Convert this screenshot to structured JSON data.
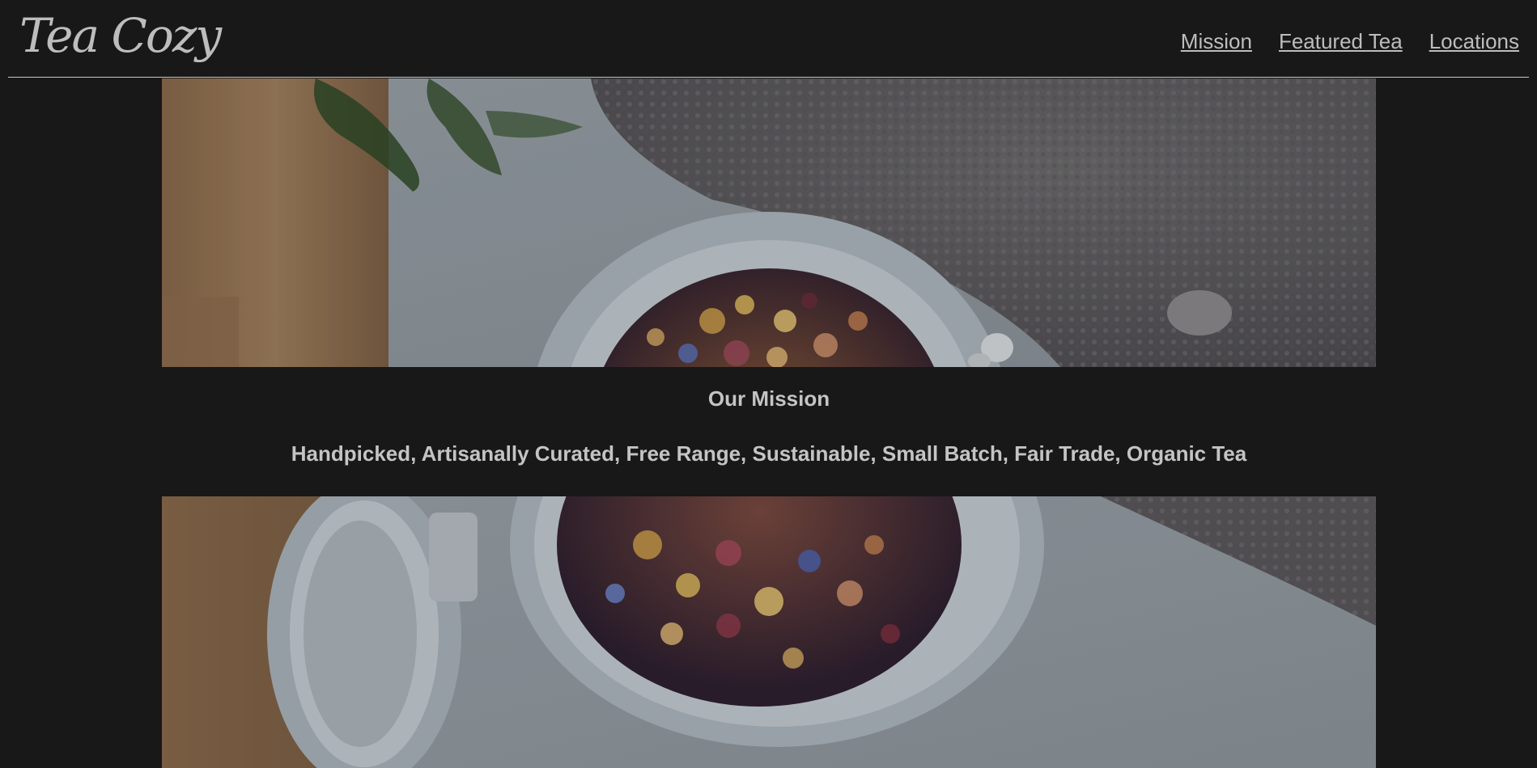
{
  "header": {
    "logo_text": "Tea Cozy",
    "nav": [
      {
        "label": "Mission"
      },
      {
        "label": "Featured Tea"
      },
      {
        "label": "Locations"
      }
    ]
  },
  "hero_images": [
    {
      "subject": "jar of loose leaf tea on table, top portion"
    },
    {
      "subject": "jar of loose leaf tea on table, bottom portion"
    }
  ],
  "mission": {
    "title": "Our Mission",
    "text": "Handpicked, Artisanally Curated, Free Range, Sustainable, Small Batch, Fair Trade, Organic Tea"
  },
  "colors": {
    "background": "#181818",
    "text": "#c4c4c4",
    "nav_link": "#bdbdbd",
    "header_border": "#c8c8c8"
  }
}
